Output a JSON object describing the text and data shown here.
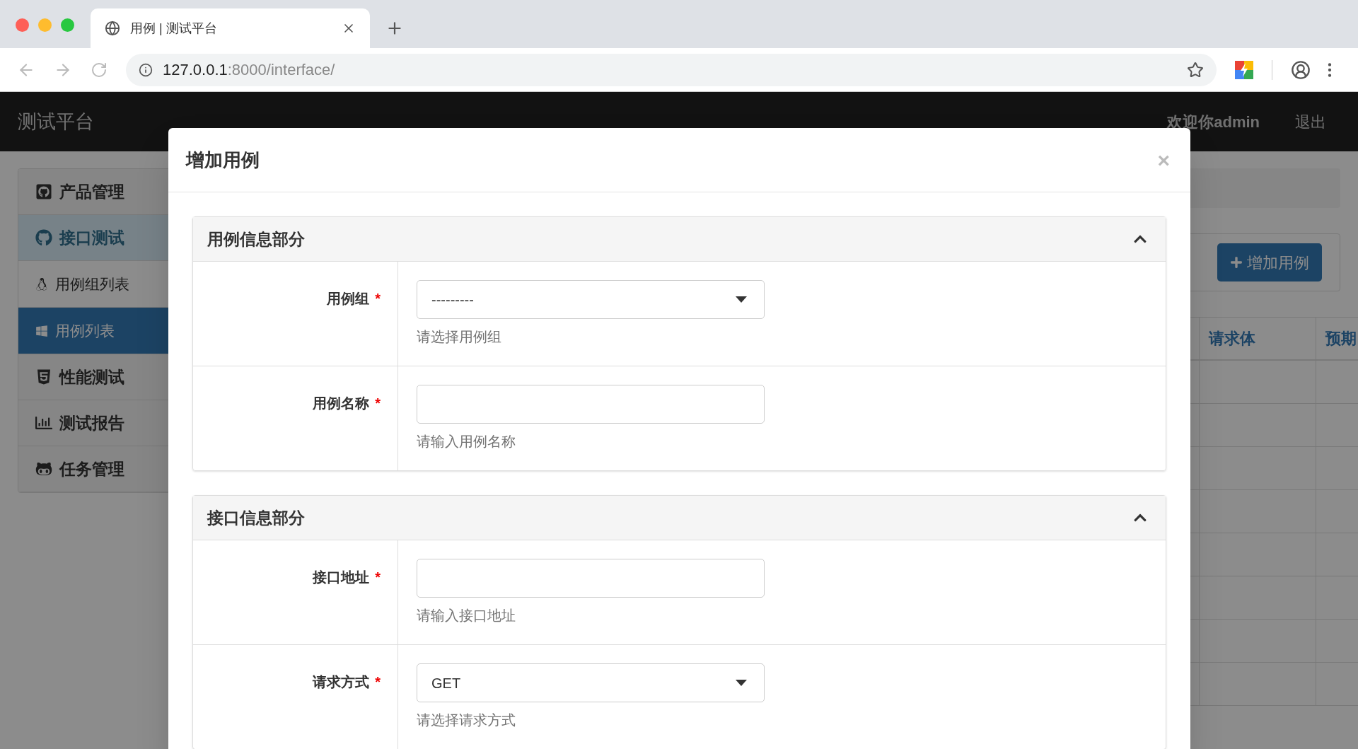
{
  "browser": {
    "tab": {
      "title": "用例 | 测试平台",
      "selected": true
    },
    "address": {
      "host": "127.0.0.1",
      "rest": ":8000/interface/"
    }
  },
  "navbar": {
    "brand": "测试平台",
    "welcome": "欢迎你admin",
    "logout": "退出"
  },
  "sidebar": {
    "items": [
      {
        "label": "产品管理",
        "selected": false
      },
      {
        "label": "接口测试",
        "selected": false,
        "expanded": true,
        "children": [
          {
            "label": "用例组列表",
            "selected": false
          },
          {
            "label": "用例列表",
            "selected": true
          }
        ]
      },
      {
        "label": "性能测试",
        "selected": false
      },
      {
        "label": "测试报告",
        "selected": false
      },
      {
        "label": "任务管理",
        "selected": false
      }
    ]
  },
  "toolbar": {
    "add_button": "增加用例"
  },
  "table": {
    "columns": [
      "请求体",
      "预期"
    ]
  },
  "modal": {
    "title": "增加用例",
    "close": "×",
    "sections": [
      {
        "title": "用例信息部分",
        "expanded": true,
        "fields": [
          {
            "kind": "select",
            "label": "用例组",
            "required_mark": "*",
            "value": "---------",
            "help": "请选择用例组"
          },
          {
            "kind": "text",
            "label": "用例名称",
            "required_mark": "*",
            "help": "请输入用例名称"
          }
        ]
      },
      {
        "title": "接口信息部分",
        "expanded": true,
        "fields": [
          {
            "kind": "text",
            "label": "接口地址",
            "required_mark": "*",
            "help": "请输入接口地址"
          },
          {
            "kind": "select",
            "label": "请求方式",
            "required_mark": "*",
            "value": "GET",
            "help": "请选择请求方式"
          }
        ]
      }
    ]
  }
}
